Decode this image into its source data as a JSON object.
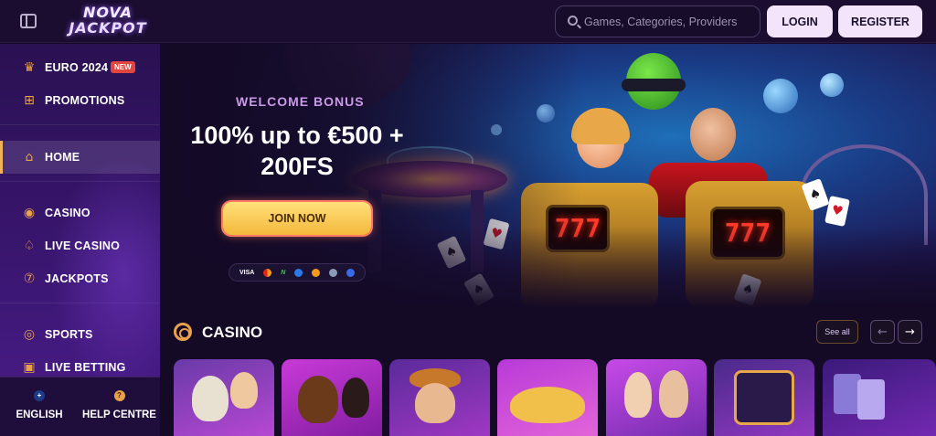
{
  "header": {
    "logo_line1": "NOVA",
    "logo_line2": "JACKPOT",
    "search_placeholder": "Games, Categories, Providers",
    "login_label": "LOGIN",
    "register_label": "REGISTER"
  },
  "sidebar": {
    "items": [
      {
        "label": "EURO 2024",
        "icon": "trophy-icon",
        "badge": "NEW"
      },
      {
        "label": "PROMOTIONS",
        "icon": "gift-icon"
      },
      {
        "label": "HOME",
        "icon": "home-icon",
        "active": true
      },
      {
        "label": "CASINO",
        "icon": "chip-icon"
      },
      {
        "label": "LIVE CASINO",
        "icon": "spade-icon"
      },
      {
        "label": "JACKPOTS",
        "icon": "seven-icon"
      },
      {
        "label": "SPORTS",
        "icon": "ball-icon"
      },
      {
        "label": "LIVE BETTING",
        "icon": "live-icon"
      }
    ],
    "footer": {
      "language_label": "ENGLISH",
      "help_label": "HELP CENTRE"
    }
  },
  "hero": {
    "welcome": "WELCOME BONUS",
    "headline": "100% up to €500 + 200FS",
    "cta_label": "JOIN NOW",
    "slot_text": "777",
    "payments": [
      "VISA",
      "N"
    ]
  },
  "casino": {
    "title": "CASINO",
    "see_all": "See all",
    "tile_count": 7
  },
  "colors": {
    "accent": "#e8a24a",
    "background": "#140a26",
    "button_light": "#f3e4fb",
    "cta": "#f3b83c",
    "badge": "#e2453e"
  }
}
